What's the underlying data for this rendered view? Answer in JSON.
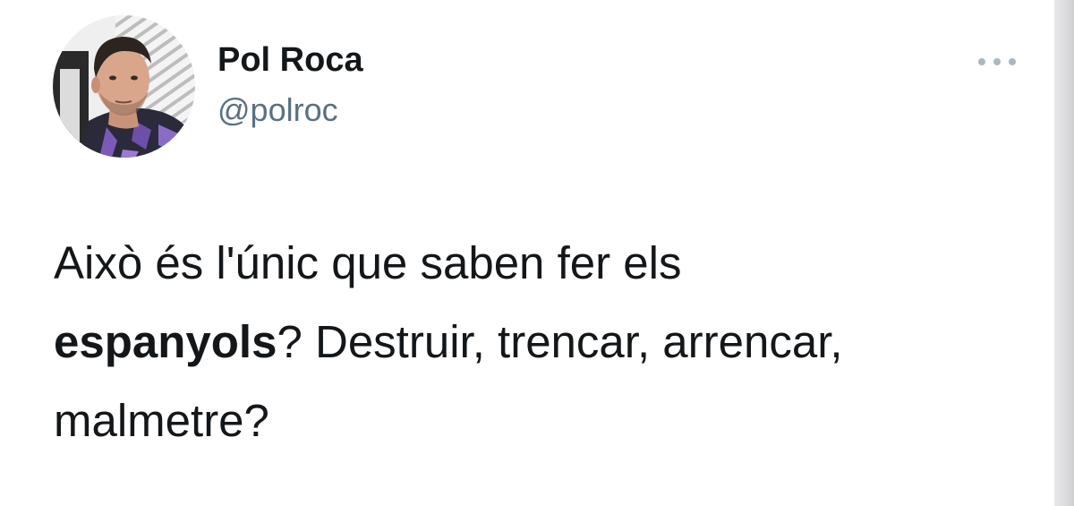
{
  "author": {
    "display_name": "Pol Roca",
    "handle": "@polroc",
    "avatar": "profile-photo"
  },
  "menu": {
    "icon": "more-options-icon"
  },
  "tweet": {
    "line1": "Això és l'únic que saben fer els",
    "bold_word": "espanyols",
    "line2_rest": "? Destruir, trencar, arrencar,",
    "line3": "malmetre?"
  },
  "colors": {
    "text": "#14171a",
    "handle": "#5b7083",
    "more_dots": "#aab8c2",
    "background": "#ffffff"
  }
}
